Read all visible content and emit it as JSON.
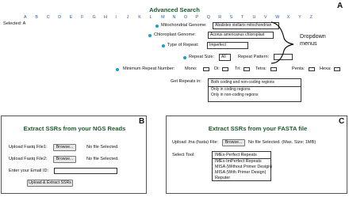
{
  "panel_a": {
    "letter": "A",
    "title": "Advanced Search",
    "alphabet": [
      "A",
      "B",
      "C",
      "D",
      "E",
      "F",
      "G",
      "H",
      "I",
      "J",
      "K",
      "L",
      "M",
      "N",
      "O",
      "P",
      "Q",
      "R",
      "S",
      "T",
      "U",
      "V",
      "W",
      "X",
      "Y",
      "Z"
    ],
    "selected_label": "Selected: A",
    "mito_label": "Mitochondrial Genome:",
    "mito_value": "Abalistes stellaris mitochondrian",
    "chloro_label": "Chloroplast Genome:",
    "chloro_value": "Acorus americanus chloroplast",
    "repeat_type_label": "Type of Repeat:",
    "repeat_type_value": "Imperfect",
    "repeat_size_label": "Repeat Size:",
    "repeat_size_value": "All",
    "repeat_pattern_label": "Repeat Pattern:",
    "min_repeat_label": "Minimum Repeat Number:",
    "mono_label": "Mono:",
    "di_label": "Di:",
    "tri_label": "Tri:",
    "tetra_label": "Tetra:",
    "penta_label": "Penta:",
    "hexa_label": "Hexa:",
    "get_repeats_label": "Get Repeats in:",
    "regions_options": [
      "Both coding and non-coding regions",
      "Only in coding regions",
      "Only in non-coding regions"
    ],
    "annotation": "Dropdown\nmenus"
  },
  "panel_b": {
    "letter": "B",
    "title": "Extract SSRs from your NGS Reads",
    "fastq1_label": "Upload Fastq File1:",
    "fastq2_label": "Upload Fastq File2:",
    "browse_label": "Browse...",
    "no_file_label": "No file Selected.",
    "email_label": "Enter your Email ID:",
    "submit_label": "Upload & Extract SSRs"
  },
  "panel_c": {
    "letter": "C",
    "title": "Extract SSRs from your FASTA file",
    "upload_label": "Upload .fna (fasta) File:",
    "browse_label": "Browse...",
    "no_file_label": "No file Selected. (Max. Size: 1MB)",
    "tool_label": "Select Tool:",
    "tool_options": [
      "IMEx-Perfect Repeats",
      "IMEx-ImPerfect Repeats",
      "MISA (Without Primer Design)",
      "MISA (With Primer Design)",
      "Reputer"
    ]
  }
}
